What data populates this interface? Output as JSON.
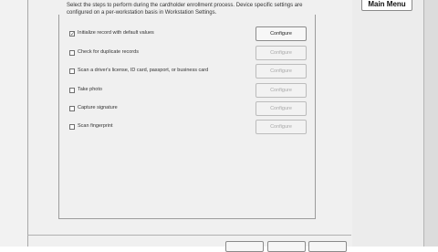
{
  "header": {
    "main_menu_label": "Main Menu"
  },
  "enrollment": {
    "description": "Select the steps to perform during the cardholder enrollment process. Device specific settings are configured on a per-workstation basis in Workstation Settings.",
    "steps": [
      {
        "label": "Initialize record with default values",
        "checked": true,
        "configure_label": "Configure",
        "configure_enabled": true
      },
      {
        "label": "Check for duplicate records",
        "checked": false,
        "configure_label": "Configure",
        "configure_enabled": false
      },
      {
        "label": "Scan a driver's license, ID card, passport, or business card",
        "checked": false,
        "configure_label": "Configure",
        "configure_enabled": false
      },
      {
        "label": "Take photo",
        "checked": false,
        "configure_label": "Configure",
        "configure_enabled": false
      },
      {
        "label": "Capture signature",
        "checked": false,
        "configure_label": "Configure",
        "configure_enabled": false
      },
      {
        "label": "Scan fingerprint",
        "checked": false,
        "configure_label": "Configure",
        "configure_enabled": false
      }
    ]
  },
  "colors": {
    "dialog_bg": "#f0f0f0",
    "disabled_text": "#a8a8a8"
  }
}
